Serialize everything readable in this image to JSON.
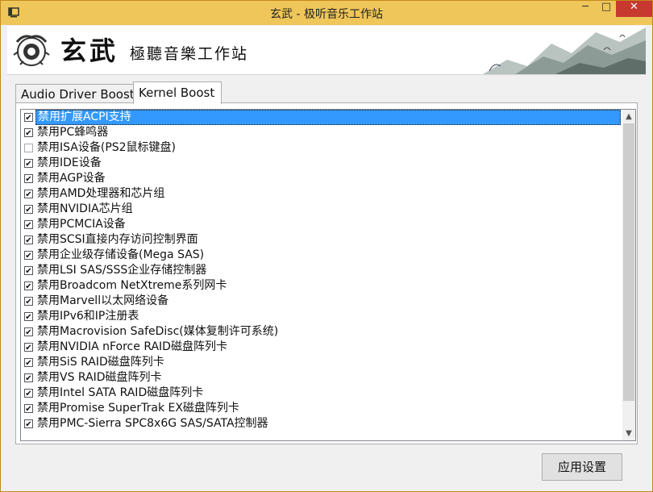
{
  "window": {
    "title": "玄武 - 极听音乐工作站",
    "minimize_glyph": "─",
    "maximize_glyph": "□",
    "close_glyph": "✕",
    "accent_color": "#efc65a"
  },
  "banner": {
    "logo_main": "玄武",
    "logo_sub": "極聽音樂工作站"
  },
  "tabs": [
    {
      "label": "Audio Driver Boost",
      "active": false
    },
    {
      "label": "Kernel Boost",
      "active": true
    }
  ],
  "options": [
    {
      "label": "禁用扩展ACPI支持",
      "checked": true,
      "selected": true
    },
    {
      "label": "禁用PC蜂鸣器",
      "checked": true
    },
    {
      "label": "禁用ISA设备(PS2鼠标键盘)",
      "checked": false
    },
    {
      "label": "禁用IDE设备",
      "checked": true
    },
    {
      "label": "禁用AGP设备",
      "checked": true
    },
    {
      "label": "禁用AMD处理器和芯片组",
      "checked": true
    },
    {
      "label": "禁用NVIDIA芯片组",
      "checked": true
    },
    {
      "label": "禁用PCMCIA设备",
      "checked": true
    },
    {
      "label": "禁用SCSI直接内存访问控制界面",
      "checked": true
    },
    {
      "label": "禁用企业级存储设备(Mega SAS)",
      "checked": true
    },
    {
      "label": "禁用LSI SAS/SSS企业存储控制器",
      "checked": true
    },
    {
      "label": "禁用Broadcom NetXtreme系列网卡",
      "checked": true
    },
    {
      "label": "禁用Marvell以太网络设备",
      "checked": true
    },
    {
      "label": "禁用IPv6和IP注册表",
      "checked": true
    },
    {
      "label": "禁用Macrovision SafeDisc(媒体复制许可系统)",
      "checked": true
    },
    {
      "label": "禁用NVIDIA nForce RAID磁盘阵列卡",
      "checked": true
    },
    {
      "label": "禁用SiS RAID磁盘阵列卡",
      "checked": true
    },
    {
      "label": "禁用VS RAID磁盘阵列卡",
      "checked": true
    },
    {
      "label": "禁用Intel SATA RAID磁盘阵列卡",
      "checked": true
    },
    {
      "label": "禁用Promise SuperTrak EX磁盘阵列卡",
      "checked": true
    },
    {
      "label": "禁用PMC-Sierra SPC8x6G SAS/SATA控制器",
      "checked": true
    }
  ],
  "scroll": {
    "up_glyph": "▲",
    "down_glyph": "▼"
  },
  "apply_label": "应用设置"
}
